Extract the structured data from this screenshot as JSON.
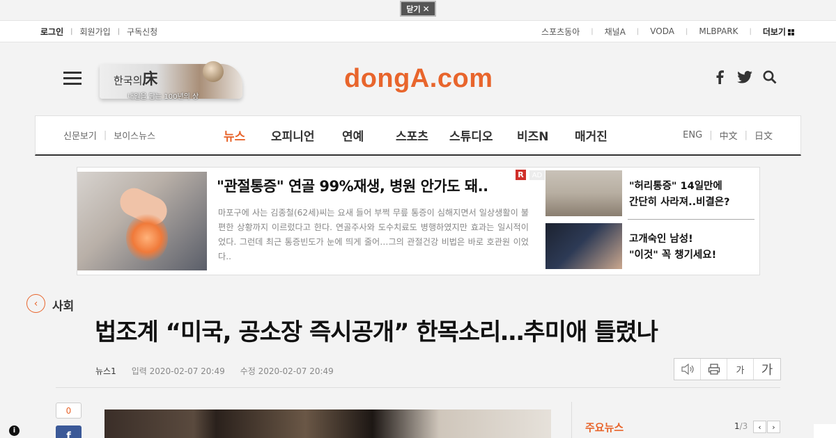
{
  "close_bar": {
    "label": "닫기",
    "icon": "close-icon"
  },
  "util": {
    "left": [
      "로그인",
      "회원가입",
      "구독신청"
    ],
    "right": [
      "스포츠동아",
      "채널A",
      "VODA",
      "MLBPARK"
    ],
    "more": "더보기"
  },
  "header": {
    "promo_title_a": "한국의",
    "promo_title_b": "床",
    "promo_sub": "내일을 담는 100년의 상",
    "logo": "dongA.com",
    "icons": [
      "facebook-icon",
      "twitter-icon",
      "search-icon"
    ]
  },
  "nav": {
    "left": [
      "신문보기",
      "보이스뉴스"
    ],
    "main": [
      "뉴스",
      "오피니언",
      "연예",
      "스포츠",
      "스튜디오",
      "비즈N",
      "매거진"
    ],
    "active_index": 0,
    "right": [
      "ENG",
      "中文",
      "日文"
    ]
  },
  "ad": {
    "title": "\"관절통증\" 연골 99%재생, 병원 안가도 돼..",
    "desc": "마포구에 사는 김종철(62세)씨는 요새 들어 부쩍 무릎 통증이 심해지면서 일상생활이 불편한 상황까지 이르렀다고 한다. 연골주사와 도수치료도 병행하였지만 효과는 일시적이었다. 그런데 최근 통증빈도가 눈에 띄게 줄어…그의 관절건강 비법은 바로 호관원 이었다..",
    "badge_r": "R",
    "badge": "AD",
    "side": [
      {
        "line1": "\"허리통증\" 14일만에",
        "line2": "간단히 사라져..비결은?"
      },
      {
        "line1": "고개숙인 남성!",
        "line2": "\"이것\" 꼭 챙기세요!"
      }
    ]
  },
  "article": {
    "section": "사회",
    "headline": "법조계 “미국, 공소장 즉시공개” 한목소리…추미애 틀렸나",
    "source": "뉴스1",
    "input_label": "입력 2020-02-07 20:49",
    "edit_label": "수정 2020-02-07 20:49",
    "tools": [
      "speaker-icon",
      "print-icon",
      "가",
      "가"
    ],
    "comment_count": "0",
    "fb": "f"
  },
  "sidebar": {
    "title": "주요뉴스",
    "page_current": "1",
    "page_total": "/3",
    "prev": "‹",
    "next": "›"
  },
  "colors": {
    "brand": "#e8652c",
    "facebook": "#3b5998",
    "ad_badge": "#d0302a"
  }
}
